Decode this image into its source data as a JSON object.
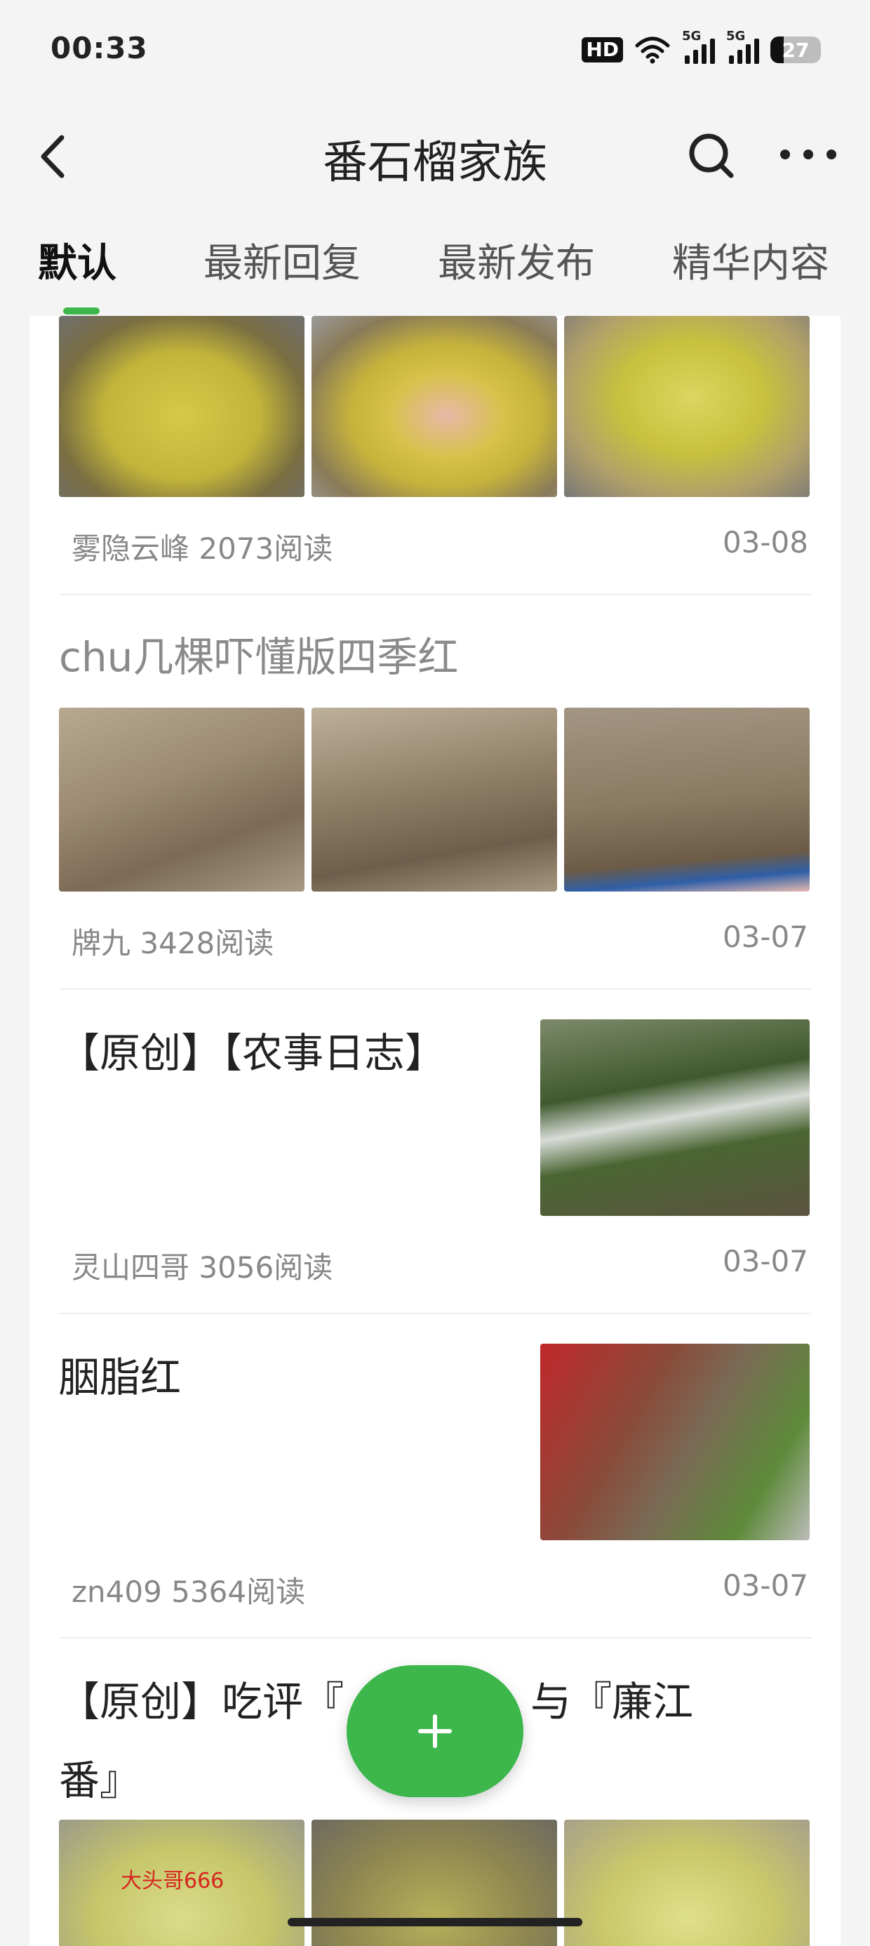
{
  "status": {
    "time": "00:33",
    "hd": "HD",
    "signal_label": "5G",
    "battery": "27",
    "battery_level": 0.27
  },
  "header": {
    "title": "番石榴家族"
  },
  "tabs": [
    "默认",
    "最新回复",
    "最新发布",
    "精华内容"
  ],
  "posts": [
    {
      "meta": "雾隐云峰 2073阅读",
      "date": "03-08"
    },
    {
      "title": "chu几棵吓懂版四季红",
      "meta": "牌九 3428阅读",
      "date": "03-07"
    },
    {
      "title": "【原创】【农事日志】",
      "meta": "灵山四哥 3056阅读",
      "date": "03-07"
    },
    {
      "title": "胭脂红",
      "meta": "zn409 5364阅读",
      "date": "03-07"
    },
    {
      "title_line1": "【原创】吃评『",
      "title_mid": "乐』与『廉江",
      "title_line2": "番』",
      "watermark": "大头哥666"
    }
  ],
  "colors": {
    "accent": "#3db74c"
  }
}
